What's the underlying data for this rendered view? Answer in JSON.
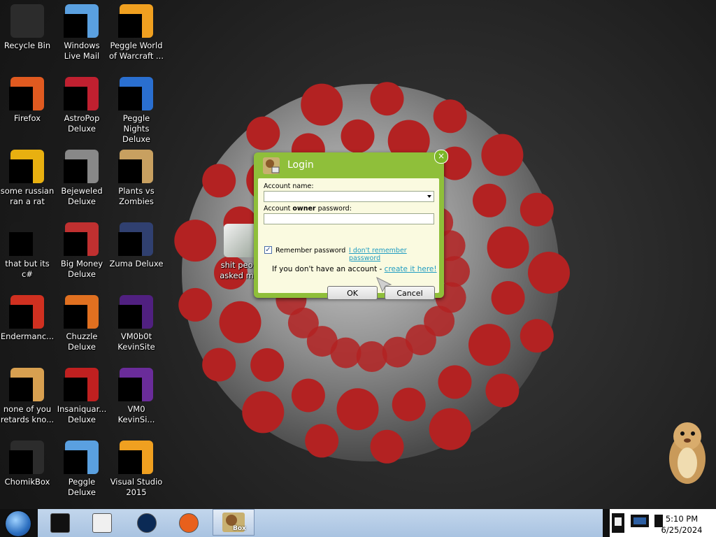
{
  "desktop": {
    "icons": [
      {
        "label": "Recycle Bin",
        "icon": "recycle-bin-icon"
      },
      {
        "label": "Windows Live Mail",
        "icon": "mail-icon"
      },
      {
        "label": "Peggle World of Warcraft ...",
        "icon": "peggle-icon"
      },
      {
        "label": "Firefox",
        "icon": "firefox-icon"
      },
      {
        "label": "AstroPop Deluxe",
        "icon": "astropop-icon"
      },
      {
        "label": "Peggle Nights Deluxe",
        "icon": "peggle-nights-icon"
      },
      {
        "label": "some russian ran a rat",
        "icon": "app-icon"
      },
      {
        "label": "Bejeweled Deluxe",
        "icon": "bejeweled-icon"
      },
      {
        "label": "Plants vs Zombies",
        "icon": "plants-vs-zombies-icon"
      },
      {
        "label": "that but its c#",
        "icon": "app-icon"
      },
      {
        "label": "Big Money Deluxe",
        "icon": "money-bag-icon"
      },
      {
        "label": "Zuma Deluxe",
        "icon": "zuma-icon"
      },
      {
        "label": "Endermanc...",
        "icon": "app-icon"
      },
      {
        "label": "Chuzzle Deluxe",
        "icon": "chuzzle-icon"
      },
      {
        "label": "VM0b0t KevinSite",
        "icon": "vm-icon"
      },
      {
        "label": "none of you retards kno...",
        "icon": "chrome-icon"
      },
      {
        "label": "Insaniquar... Deluxe",
        "icon": "fish-icon"
      },
      {
        "label": "VM0 KevinSi...",
        "icon": "vm-icon"
      },
      {
        "label": "ChomikBox",
        "icon": "chomikbox-icon"
      },
      {
        "label": "Peggle Deluxe",
        "icon": "peggle-icon"
      },
      {
        "label": "Visual Studio 2015",
        "icon": "visual-studio-icon"
      }
    ],
    "partial_icon": {
      "label": "shit peo... asked m...",
      "icon": "folder-icon"
    }
  },
  "login": {
    "title": "Login",
    "close_glyph": "×",
    "account_name_label": "Account name:",
    "account_name_value": "",
    "password_label_pre": "Account ",
    "password_label_bold": "owner",
    "password_label_post": " password:",
    "password_value": "",
    "remember_label": "Remember password",
    "remember_checked": "✓",
    "forgot_link": "I don't remember password",
    "no_account_text": "If you don't have an account - ",
    "create_link": "create it here!",
    "ok_label": "OK",
    "cancel_label": "Cancel"
  },
  "taskbar": {
    "start": "start-orb-icon",
    "pinned": [
      "monitor-icon",
      "media-player-icon",
      "globe-icon",
      "firefox-icon"
    ],
    "active_item": "chomikbox-icon",
    "active_item_label": "Box"
  },
  "tray": {
    "time": "5:10 PM",
    "date": "6/25/2024"
  },
  "colors": {
    "dialog_green": "#8fbf3a",
    "dialog_body": "#fafae0",
    "link": "#1f9cc1",
    "taskbar": "#b4cbe6",
    "virus_red": "#b32222"
  }
}
